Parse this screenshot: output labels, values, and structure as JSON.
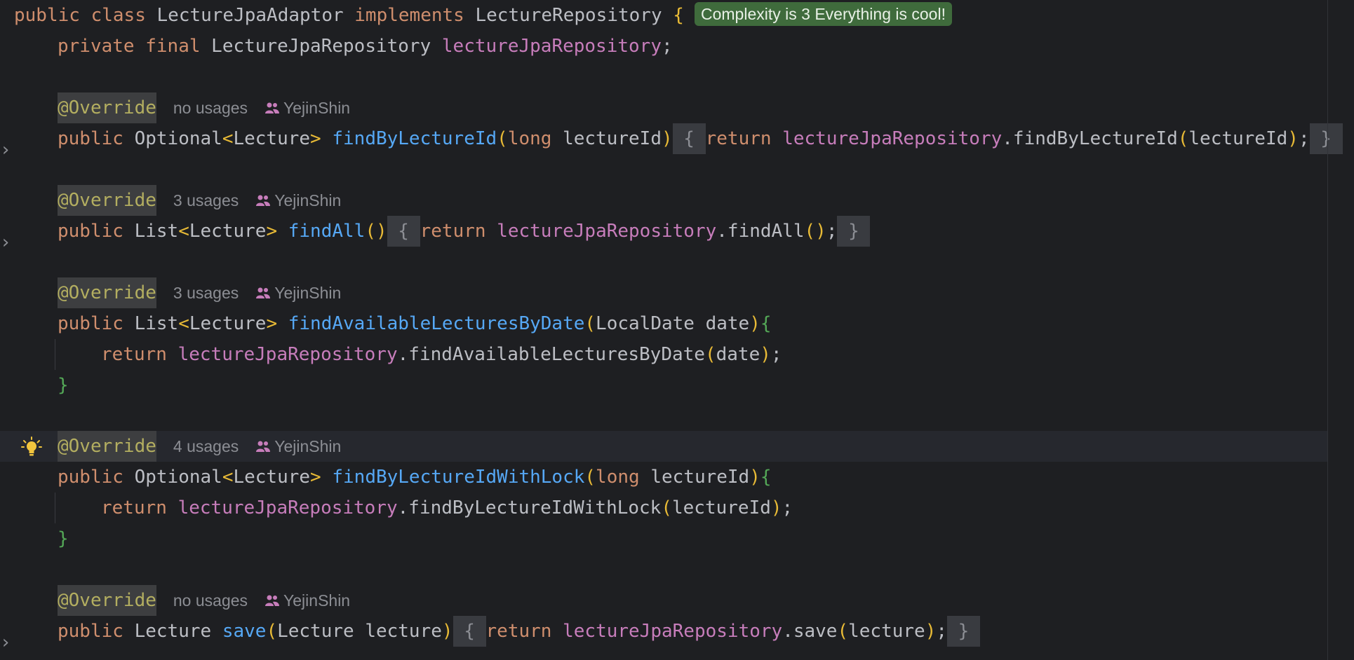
{
  "editor": {
    "badge": "Complexity is 3 Everything is cool!",
    "class_decl": {
      "public": "public",
      "class": "class",
      "name": "LectureJpaAdaptor",
      "implements": "implements",
      "iface": "LectureRepository",
      "brace": "{"
    },
    "field_line": {
      "private": "private",
      "final": "final",
      "type": "LectureJpaRepository",
      "name": "lectureJpaRepository",
      "semi": ";"
    },
    "methods": [
      {
        "annotation": "@Override",
        "usages": "no usages",
        "author": "YejinShin",
        "public": "public",
        "rtype": "Optional",
        "generic": "Lecture",
        "name": "findByLectureId",
        "param_type": "long",
        "param": "lectureId",
        "ret": "return",
        "field": "lectureJpaRepository",
        "call": ".findByLectureId",
        "arg": "lectureId"
      },
      {
        "annotation": "@Override",
        "usages": "3 usages",
        "author": "YejinShin",
        "public": "public",
        "rtype": "List",
        "generic": "Lecture",
        "name": "findAll",
        "ret": "return",
        "field": "lectureJpaRepository",
        "call": ".findAll"
      },
      {
        "annotation": "@Override",
        "usages": "3 usages",
        "author": "YejinShin",
        "public": "public",
        "rtype": "List",
        "generic": "Lecture",
        "name": "findAvailableLecturesByDate",
        "params": "LocalDate date",
        "ret": "return",
        "field": "lectureJpaRepository",
        "call": ".findAvailableLecturesByDate",
        "arg": "date"
      },
      {
        "annotation": "@Override",
        "usages": "4 usages",
        "author": "YejinShin",
        "public": "public",
        "rtype": "Optional",
        "generic": "Lecture",
        "name": "findByLectureIdWithLock",
        "param_type": "long",
        "param": "lectureId",
        "ret": "return",
        "field": "lectureJpaRepository",
        "call": ".findByLectureIdWithLock",
        "arg": "lectureId"
      },
      {
        "annotation": "@Override",
        "usages": "no usages",
        "author": "YejinShin",
        "public": "public",
        "rtype": "Lecture",
        "name": "save",
        "params": "Lecture lecture",
        "ret": "return",
        "field": "lectureJpaRepository",
        "call": ".save",
        "arg": "lecture"
      }
    ],
    "colors": {
      "background": "#1e1f22",
      "keyword": "#cf8e6d",
      "method": "#56a8f5",
      "field": "#c77dbb",
      "annotation": "#b3ae60",
      "badge": "#3f6b3c"
    },
    "icons": [
      "person-icon",
      "lightbulb-icon",
      "fold-marker-icon"
    ]
  }
}
